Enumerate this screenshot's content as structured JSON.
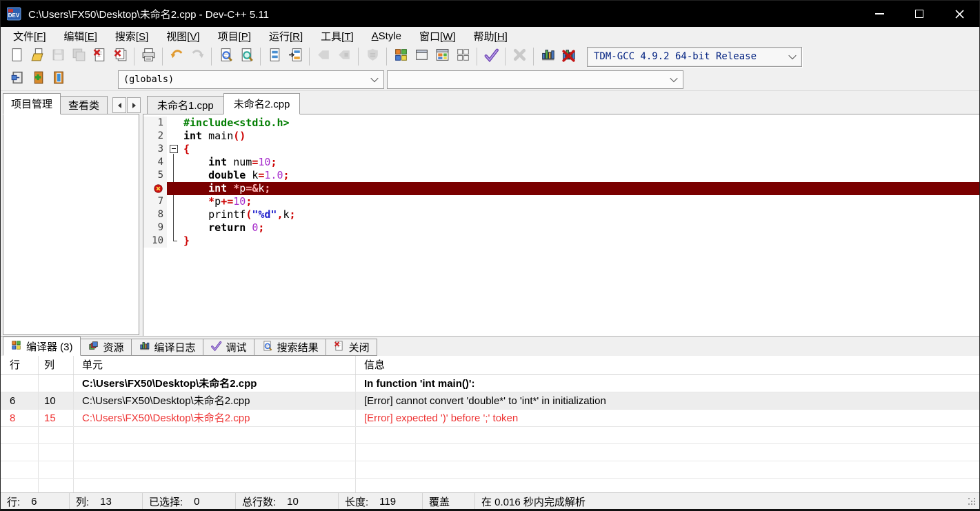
{
  "window": {
    "title": "C:\\Users\\FX50\\Desktop\\未命名2.cpp - Dev-C++ 5.11",
    "app_icon": "dev-cpp-logo"
  },
  "menu": {
    "items": [
      "文件[F]",
      "编辑[E]",
      "搜索[S]",
      "视图[V]",
      "项目[P]",
      "运行[R]",
      "工具[T]",
      "AStyle",
      "窗口[W]",
      "帮助[H]"
    ]
  },
  "toolbar_main": {
    "compiler": "TDM-GCC 4.9.2 64-bit Release",
    "groups": [
      {
        "items": [
          {
            "name": "new-source-file",
            "icon": "new-file",
            "disabled": false
          },
          {
            "name": "open-file",
            "icon": "open-file",
            "disabled": false
          },
          {
            "name": "save",
            "icon": "save",
            "disabled": true
          },
          {
            "name": "save-all",
            "icon": "save-all",
            "disabled": true
          },
          {
            "name": "close-file",
            "icon": "close-file",
            "disabled": false
          },
          {
            "name": "close-all",
            "icon": "close-all",
            "disabled": false
          }
        ]
      },
      {
        "items": [
          {
            "name": "print",
            "icon": "print",
            "disabled": false
          }
        ]
      },
      {
        "items": [
          {
            "name": "undo",
            "icon": "undo",
            "disabled": false
          },
          {
            "name": "redo",
            "icon": "redo",
            "disabled": true
          }
        ]
      },
      {
        "items": [
          {
            "name": "find",
            "icon": "find",
            "disabled": false
          },
          {
            "name": "find-in-files",
            "icon": "find-in-files",
            "disabled": false
          }
        ]
      },
      {
        "items": [
          {
            "name": "replace",
            "icon": "replace",
            "disabled": false
          },
          {
            "name": "replace-all",
            "icon": "replace-all",
            "disabled": false
          }
        ]
      },
      {
        "items": [
          {
            "name": "debug-back",
            "icon": "debug-back",
            "disabled": true
          },
          {
            "name": "debug-next",
            "icon": "debug-next",
            "disabled": true
          }
        ]
      },
      {
        "items": [
          {
            "name": "debug-stop",
            "icon": "debug-stop",
            "disabled": true
          }
        ]
      },
      {
        "items": [
          {
            "name": "compile",
            "icon": "compile",
            "disabled": false
          },
          {
            "name": "run",
            "icon": "run",
            "disabled": false
          },
          {
            "name": "compile-and-run",
            "icon": "compile-run",
            "disabled": false
          },
          {
            "name": "rebuild-all",
            "icon": "rebuild-all",
            "disabled": false
          }
        ]
      },
      {
        "items": [
          {
            "name": "syntax-check",
            "icon": "syntax-check",
            "disabled": false
          }
        ]
      },
      {
        "items": [
          {
            "name": "abort-compilation",
            "icon": "abort",
            "disabled": true
          }
        ]
      },
      {
        "items": [
          {
            "name": "profile-analysis",
            "icon": "profile",
            "disabled": false
          },
          {
            "name": "delete-profiling",
            "icon": "delete-profiling",
            "disabled": false
          }
        ]
      }
    ]
  },
  "toolbar_nav": {
    "buttons": [
      {
        "name": "insert",
        "icon": "insert"
      },
      {
        "name": "toggle-bookmark",
        "icon": "toggle-bookmark"
      },
      {
        "name": "goto-bookmark",
        "icon": "goto-bookmark"
      }
    ],
    "scope_value": "(globals)",
    "member_value": ""
  },
  "left_panel": {
    "tabs": [
      "项目管理",
      "查看类"
    ],
    "active": 0
  },
  "editor": {
    "tabs": [
      "未命名1.cpp",
      "未命名2.cpp"
    ],
    "active": 1,
    "lines": [
      {
        "num": "1",
        "fold": "",
        "err": false,
        "tokens": [
          {
            "t": "#include<stdio.h>",
            "c": "pp"
          }
        ]
      },
      {
        "num": "2",
        "fold": "",
        "err": false,
        "tokens": [
          {
            "t": "int",
            "c": "kw"
          },
          {
            "t": " main",
            "c": "pl"
          },
          {
            "t": "()",
            "c": "sym"
          }
        ]
      },
      {
        "num": "3",
        "fold": "box",
        "err": false,
        "tokens": [
          {
            "t": "{",
            "c": "sym"
          }
        ]
      },
      {
        "num": "4",
        "fold": "line",
        "err": false,
        "tokens": [
          {
            "t": "    ",
            "c": "pl"
          },
          {
            "t": "int",
            "c": "kw"
          },
          {
            "t": " num",
            "c": "pl"
          },
          {
            "t": "=",
            "c": "sym"
          },
          {
            "t": "10",
            "c": "num"
          },
          {
            "t": ";",
            "c": "sym"
          }
        ]
      },
      {
        "num": "5",
        "fold": "line",
        "err": false,
        "tokens": [
          {
            "t": "    ",
            "c": "pl"
          },
          {
            "t": "double",
            "c": "kw"
          },
          {
            "t": " k",
            "c": "pl"
          },
          {
            "t": "=",
            "c": "sym"
          },
          {
            "t": "1.0",
            "c": "num"
          },
          {
            "t": ";",
            "c": "sym"
          }
        ]
      },
      {
        "num": "6",
        "fold": "line",
        "err": true,
        "tokens": [
          {
            "t": "    ",
            "c": "pl"
          },
          {
            "t": "int",
            "c": "kw"
          },
          {
            "t": " ",
            "c": "pl"
          },
          {
            "t": "*",
            "c": "sym"
          },
          {
            "t": "p",
            "c": "pl"
          },
          {
            "t": "=&",
            "c": "sym"
          },
          {
            "t": "k",
            "c": "pl"
          },
          {
            "t": ";",
            "c": "sym"
          }
        ]
      },
      {
        "num": "7",
        "fold": "line",
        "err": false,
        "tokens": [
          {
            "t": "    ",
            "c": "pl"
          },
          {
            "t": "*",
            "c": "sym"
          },
          {
            "t": "p",
            "c": "pl"
          },
          {
            "t": "+=",
            "c": "sym"
          },
          {
            "t": "10",
            "c": "num"
          },
          {
            "t": ";",
            "c": "sym"
          }
        ]
      },
      {
        "num": "8",
        "fold": "line",
        "err": false,
        "tokens": [
          {
            "t": "    printf",
            "c": "pl"
          },
          {
            "t": "(",
            "c": "sym"
          },
          {
            "t": "\"%d\"",
            "c": "str"
          },
          {
            "t": ",",
            "c": "sym"
          },
          {
            "t": "k",
            "c": "pl"
          },
          {
            "t": ";",
            "c": "sym"
          }
        ]
      },
      {
        "num": "9",
        "fold": "line",
        "err": false,
        "tokens": [
          {
            "t": "    ",
            "c": "pl"
          },
          {
            "t": "return",
            "c": "kw"
          },
          {
            "t": " ",
            "c": "pl"
          },
          {
            "t": "0",
            "c": "num"
          },
          {
            "t": ";",
            "c": "sym"
          }
        ]
      },
      {
        "num": "10",
        "fold": "end",
        "err": false,
        "tokens": [
          {
            "t": "}",
            "c": "sym"
          }
        ]
      }
    ],
    "error_marker_line": "6"
  },
  "report": {
    "active": 0,
    "tabs": [
      {
        "label": "编译器 (3)",
        "icon": "compiler-tab"
      },
      {
        "label": "资源",
        "icon": "resource-tab"
      },
      {
        "label": "编译日志",
        "icon": "log-tab"
      },
      {
        "label": "调试",
        "icon": "debug-tab"
      },
      {
        "label": "搜索结果",
        "icon": "search-tab"
      },
      {
        "label": "关闭",
        "icon": "close-tab"
      }
    ],
    "columns": [
      "行",
      "列",
      "单元",
      "信息"
    ],
    "rows": [
      {
        "line": "",
        "col": "",
        "unit": "C:\\Users\\FX50\\Desktop\\未命名2.cpp",
        "message": "In function 'int main()':",
        "style": "unit"
      },
      {
        "line": "6",
        "col": "10",
        "unit": "C:\\Users\\FX50\\Desktop\\未命名2.cpp",
        "message": "[Error] cannot convert 'double*' to 'int*' in initialization",
        "style": "selected"
      },
      {
        "line": "8",
        "col": "15",
        "unit": "C:\\Users\\FX50\\Desktop\\未命名2.cpp",
        "message": "[Error] expected ')' before ';' token",
        "style": "error"
      }
    ]
  },
  "statusbar": {
    "sections": [
      {
        "label": "行:",
        "value": "6"
      },
      {
        "label": "列:",
        "value": "13"
      },
      {
        "label": "已选择:",
        "value": "0"
      },
      {
        "label": "总行数:",
        "value": "10"
      },
      {
        "label": "长度:",
        "value": "119"
      },
      {
        "label": "覆盖",
        "value": ""
      },
      {
        "label": "在 0.016 秒内完成解析",
        "value": ""
      }
    ]
  },
  "colors": {
    "error_line_bg": "#7a0000",
    "error_text": "#ee3333",
    "preprocessor": "#007d00",
    "number": "#a62ccb",
    "string": "#2222cc",
    "symbol": "#cc0000",
    "compiler_combo_text": "#002080"
  }
}
